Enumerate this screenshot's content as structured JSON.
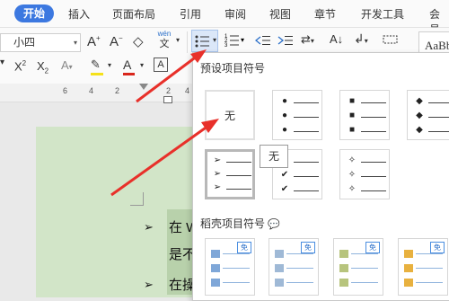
{
  "menubar": {
    "tabs": [
      "开始",
      "插入",
      "页面布局",
      "引用",
      "审阅",
      "视图",
      "章节",
      "开发工具",
      "会员"
    ]
  },
  "toolbar": {
    "font_size": "小四",
    "style_preview": "AaBb",
    "wen_label": "wén",
    "icons": [
      "grow-font-icon",
      "shrink-font-icon",
      "clear-format-icon",
      "pinyin-icon",
      "bullet-list-icon",
      "numbered-list-icon",
      "decrease-indent-icon",
      "increase-indent-icon",
      "text-direction-icon",
      "sort-icon",
      "line-spacing-icon",
      "border-icon",
      "superscript-icon",
      "subscript-icon",
      "highlight-icon",
      "font-color-icon",
      "char-border-icon"
    ],
    "colors": {
      "highlight": "#f5e11a",
      "font_color": "#d9261c",
      "accent": "#3c78e0"
    }
  },
  "ruler": {
    "ticks": [
      "6",
      "4",
      "2",
      "2",
      "4"
    ]
  },
  "dropdown": {
    "preset_title": "预设项目符号",
    "none_label": "无",
    "tooltip": "无",
    "wps_title": "稻壳项目符号",
    "wps_badge": "免",
    "preset_glyphs": [
      "●",
      "■",
      "◆",
      "➢",
      "✔",
      "✧"
    ]
  },
  "document": {
    "lines": [
      {
        "bullet": "➢",
        "text": "在 W"
      },
      {
        "bullet": "",
        "text": "是不"
      },
      {
        "bullet": "➢",
        "text": "在操"
      }
    ]
  }
}
